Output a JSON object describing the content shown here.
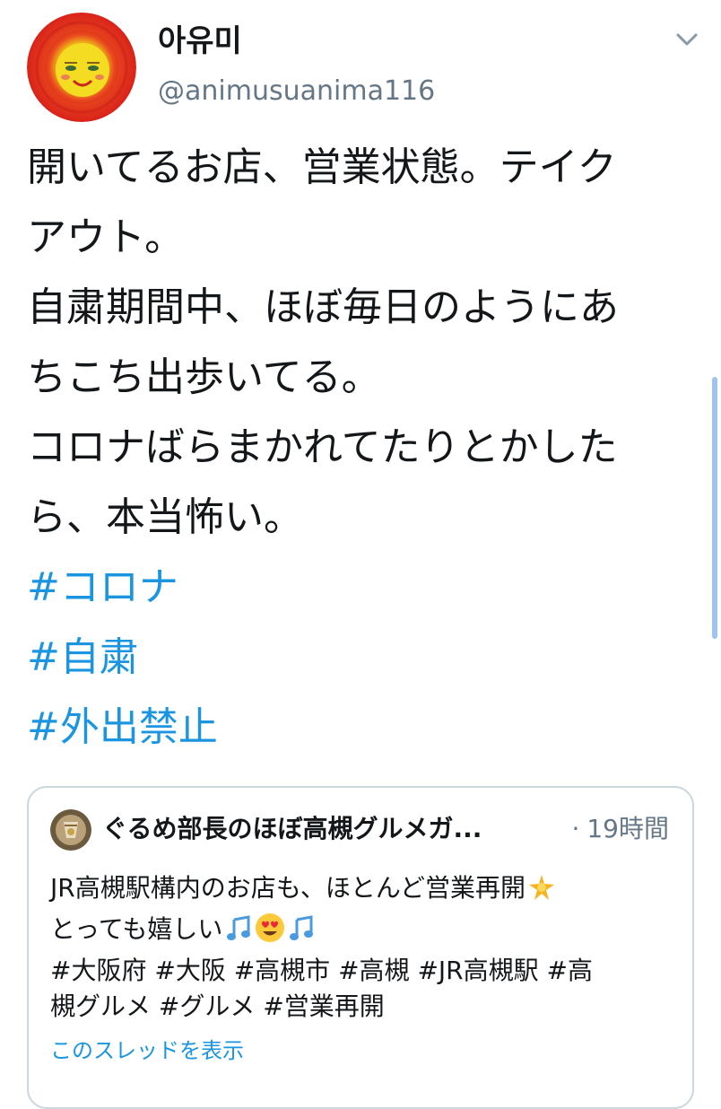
{
  "tweet": {
    "author": {
      "display_name": "아유미",
      "handle": "@animusuanima116",
      "avatar_icon": "sun-face-avatar"
    },
    "menu_icon": "chevron-down-icon",
    "text_lines": [
      "開いてるお店、営業状態。テイク",
      "アウト。",
      "自粛期間中、ほぼ毎日のようにあ",
      "ちこち出歩いてる。",
      "コロナばらまかれてたりとかした",
      "ら、本当怖い。"
    ],
    "hashtags": [
      "#コロナ",
      "#自粛",
      "#外出禁止"
    ]
  },
  "quoted_tweet": {
    "author_name": "ぐるめ部長のほぼ高槻グルメガ...",
    "time_separator": "·",
    "time": "19時間",
    "text_lines": [
      "JR高槻駅構内のお店も、ほとんど営業再開",
      "とっても嬉しい",
      "#大阪府 #大阪 #高槻市 #高槻 #JR高槻駅 #高",
      "槻グルメ #グルメ #営業再開"
    ],
    "emojis": [
      "star-emoji",
      "music-note-emoji",
      "heart-eyes-emoji",
      "music-note-emoji"
    ],
    "show_thread_label": "このスレッドを表示"
  },
  "colors": {
    "link": "#1b95e0",
    "text": "#14171a",
    "secondary": "#657786",
    "border": "#ccd6dd"
  }
}
